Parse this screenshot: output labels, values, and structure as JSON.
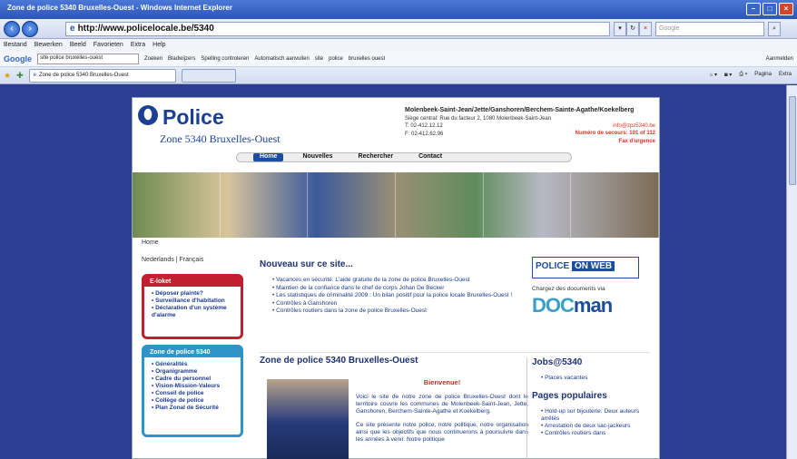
{
  "window": {
    "title": "Zone de police 5340 Bruxelles-Ouest - Windows Internet Explorer"
  },
  "address": {
    "url": "http://www.policelocale.be/5340",
    "search_placeholder": "Google"
  },
  "menu": [
    "Bestand",
    "Bewerken",
    "Beeld",
    "Favorieten",
    "Extra",
    "Help"
  ],
  "google_bar": {
    "logo": "Google",
    "query": "site police bruxelles-ouest",
    "zoeken": "Zoeken",
    "bladwijzers": "Bladwijzers",
    "spelling": "Spelling controleren",
    "auto": "Automatisch aanvullen",
    "site": "site",
    "police": "police",
    "bruxelles": "bruxelles ouest",
    "aanmelden": "Aanmelden"
  },
  "tab": {
    "label": "Zone de police 5340 Bruxelles-Ouest",
    "pagina": "Pagina",
    "extra": "Extra"
  },
  "site": {
    "logo": "Police",
    "zone": "Zone 5340 Bruxelles-Ouest",
    "communes": "Molenbeek-Saint-Jean/Jette/Ganshoren/Berchem-Sainte-Agathe/Koekelberg",
    "siege": "Siège central: Rue du facteur 2, 1080 Molenbeek-Saint-Jean",
    "tel": "T: 02-412.12.12",
    "fax": "F: 02-412.62.96",
    "email": "info@zpz5340.be",
    "secours": "Numéro de secours: 101 of 112",
    "urgence": "Fax d'urgence",
    "nav": [
      "Home",
      "Nouvelles",
      "Rechercher",
      "Contact"
    ],
    "breadcrumb": "Home",
    "lang": "Nederlands | Français",
    "eloket": {
      "title": "E-loket",
      "items": [
        "Déposer plainte?",
        "Surveillance d'habitation",
        "Déclaration d'un système d'alarme"
      ]
    },
    "zone_box": {
      "title": "Zone de police 5340",
      "items": [
        "Généralités",
        "Organigramme",
        "Cadre du personnel",
        "Vision-Mission-Valeurs",
        "Conseil de police",
        "Collège de police",
        "Plan Zonal de Sécurité"
      ]
    },
    "news_title": "Nouveau sur ce site...",
    "news": [
      "Vacances en sécurité. L'aide gratuite de la zone de police Bruxelles-Ouest",
      "Maintien de la confiance dans le chef de corps Johan De Becker",
      "Les statistiques de criminalité 2009 : Un bilan positif pour la police locale Bruxelles-Ouest !",
      "Contrôles à Ganshoren",
      "Contrôles routiers dans la zone de police Bruxelles-Ouest"
    ],
    "pow": {
      "a": "POLICE",
      "b": "ON WEB"
    },
    "charge": "Chargez des documents via",
    "docman": {
      "a": "DOC",
      "b": "man"
    },
    "zone_title": "Zone de police 5340 Bruxelles-Ouest",
    "bienvenue": "Bienvenue!",
    "welcome_p1": "Voici le site de notre zone de police Bruxelles-Ouest dont le territoire couvre les communes de Molenbeek-Saint-Jean, Jette, Ganshoren, Berchem-Sainte-Agathe et Koekelberg.",
    "welcome_p2": "Ce site présente notre police, notre politique, notre organisation ainsi que les objectifs que nous continuerons à poursuivre dans les années à venir. Notre politique",
    "jobs_title": "Jobs@5340",
    "jobs": [
      "Places vacantes"
    ],
    "popular_title": "Pages populaires",
    "popular": [
      "Hold-up sur bijouterie: Deux auteurs arrêtés",
      "Arrestation de deux sac-jackeurs",
      "Contrôles routiers dans"
    ]
  }
}
